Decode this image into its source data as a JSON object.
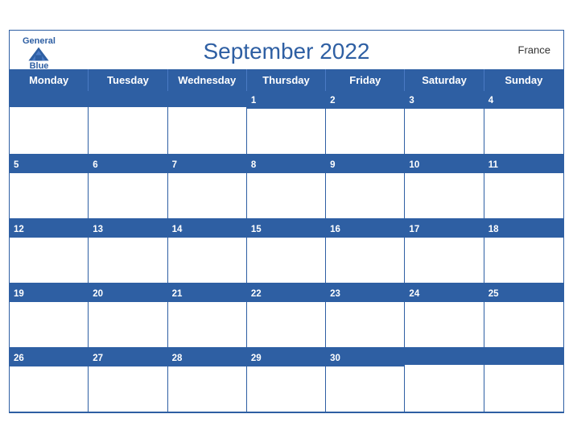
{
  "header": {
    "title": "September 2022",
    "country": "France",
    "logo_general": "General",
    "logo_blue": "Blue"
  },
  "days": {
    "headers": [
      "Monday",
      "Tuesday",
      "Wednesday",
      "Thursday",
      "Friday",
      "Saturday",
      "Sunday"
    ]
  },
  "weeks": [
    [
      {
        "num": "",
        "empty": true
      },
      {
        "num": "",
        "empty": true
      },
      {
        "num": "",
        "empty": true
      },
      {
        "num": "1",
        "empty": false
      },
      {
        "num": "2",
        "empty": false
      },
      {
        "num": "3",
        "empty": false
      },
      {
        "num": "4",
        "empty": false
      }
    ],
    [
      {
        "num": "5",
        "empty": false
      },
      {
        "num": "6",
        "empty": false
      },
      {
        "num": "7",
        "empty": false
      },
      {
        "num": "8",
        "empty": false
      },
      {
        "num": "9",
        "empty": false
      },
      {
        "num": "10",
        "empty": false
      },
      {
        "num": "11",
        "empty": false
      }
    ],
    [
      {
        "num": "12",
        "empty": false
      },
      {
        "num": "13",
        "empty": false
      },
      {
        "num": "14",
        "empty": false
      },
      {
        "num": "15",
        "empty": false
      },
      {
        "num": "16",
        "empty": false
      },
      {
        "num": "17",
        "empty": false
      },
      {
        "num": "18",
        "empty": false
      }
    ],
    [
      {
        "num": "19",
        "empty": false
      },
      {
        "num": "20",
        "empty": false
      },
      {
        "num": "21",
        "empty": false
      },
      {
        "num": "22",
        "empty": false
      },
      {
        "num": "23",
        "empty": false
      },
      {
        "num": "24",
        "empty": false
      },
      {
        "num": "25",
        "empty": false
      }
    ],
    [
      {
        "num": "26",
        "empty": false
      },
      {
        "num": "27",
        "empty": false
      },
      {
        "num": "28",
        "empty": false
      },
      {
        "num": "29",
        "empty": false
      },
      {
        "num": "30",
        "empty": false
      },
      {
        "num": "",
        "empty": true
      },
      {
        "num": "",
        "empty": true
      }
    ]
  ]
}
